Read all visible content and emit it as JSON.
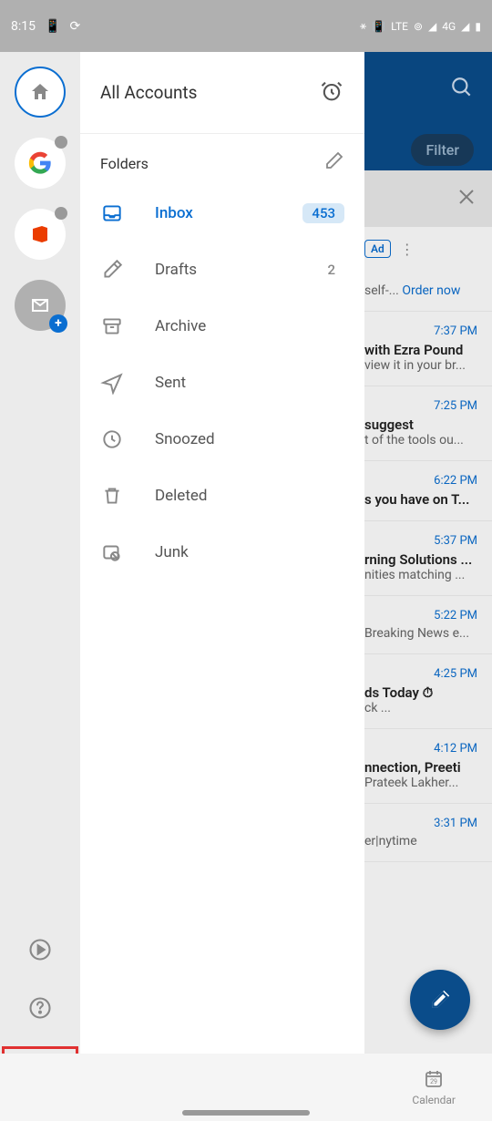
{
  "status": {
    "time": "8:15",
    "network_label": "4G"
  },
  "header": {
    "filter_label": "Filter"
  },
  "drawer": {
    "title": "All Accounts",
    "folders_label": "Folders",
    "folders": [
      {
        "label": "Inbox",
        "count": "453",
        "icon": "inbox"
      },
      {
        "label": "Drafts",
        "count": "2",
        "icon": "drafts"
      },
      {
        "label": "Archive",
        "count": "",
        "icon": "archive"
      },
      {
        "label": "Sent",
        "count": "",
        "icon": "sent"
      },
      {
        "label": "Snoozed",
        "count": "",
        "icon": "snoozed"
      },
      {
        "label": "Deleted",
        "count": "",
        "icon": "deleted"
      },
      {
        "label": "Junk",
        "count": "",
        "icon": "junk"
      }
    ]
  },
  "emails": [
    {
      "time": "",
      "subject": "self-...",
      "preview": "",
      "order": "Order now",
      "ad": true
    },
    {
      "time": "7:37 PM",
      "subject": "with Ezra Pound",
      "preview": "view it in your br..."
    },
    {
      "time": "7:25 PM",
      "subject": "suggest",
      "preview": "t of the tools ou..."
    },
    {
      "time": "6:22 PM",
      "subject": "s you have on T...",
      "preview": ""
    },
    {
      "time": "5:37 PM",
      "subject": "rning Solutions ...",
      "preview": "nities matching ..."
    },
    {
      "time": "5:22 PM",
      "subject": "",
      "preview": "Breaking News e..."
    },
    {
      "time": "4:25 PM",
      "subject": "ds Today ⏱",
      "preview": "ck                                  ..."
    },
    {
      "time": "4:12 PM",
      "subject": "nnection, Preeti",
      "preview": "Prateek Lakher..."
    },
    {
      "time": "3:31 PM",
      "subject": "",
      "preview": "er|nytime"
    }
  ],
  "ad": {
    "badge_label": "Ad"
  },
  "bottom_nav": {
    "calendar_label": "Calendar"
  }
}
